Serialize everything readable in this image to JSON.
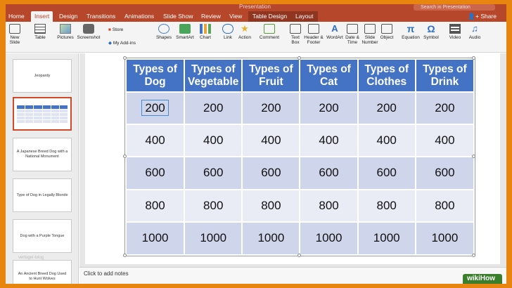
{
  "window": {
    "title": "Presentation",
    "search_placeholder": "Search in Presentation"
  },
  "tabs": [
    "Home",
    "Insert",
    "Design",
    "Transitions",
    "Animations",
    "Slide Show",
    "Review",
    "View"
  ],
  "active_tab": "Insert",
  "context_tabs": [
    "Table Design",
    "Layout"
  ],
  "share_label": "Share",
  "toolbar": {
    "new_slide": "New\nSlide",
    "table": "Table",
    "pictures": "Pictures",
    "screenshot": "Screenshot",
    "store": "Store",
    "my_addins": "My Add-ins",
    "shapes": "Shapes",
    "smartart": "SmartArt",
    "chart": "Chart",
    "link": "Link",
    "action": "Action",
    "comment": "Comment",
    "text_box": "Text\nBox",
    "header_footer": "Header &\nFooter",
    "wordart": "WordArt",
    "date_time": "Date &\nTime",
    "slide_number": "Slide\nNumber",
    "object": "Object",
    "equation": "Equation",
    "symbol": "Symbol",
    "video": "Video",
    "audio": "Audio"
  },
  "slides": [
    {
      "text": "Jeopardy"
    },
    {
      "text": ""
    },
    {
      "text": "A Japanese Breed Dog with a National Monument"
    },
    {
      "text": "Type of Dog in Legally Blonde"
    },
    {
      "text": "Dog with a Purple Tongue"
    },
    {
      "text": "An Ancient Breed Dog Used to Hunt Wolves"
    }
  ],
  "watermark": "vertogel-tvlog",
  "table": {
    "headers": [
      "Types of Dog",
      "Types of Vegetable",
      "Types of Fruit",
      "Types of Cat",
      "Types of Clothes",
      "Types of Drink"
    ],
    "rows": [
      [
        "200",
        "200",
        "200",
        "200",
        "200",
        "200"
      ],
      [
        "400",
        "400",
        "400",
        "400",
        "400",
        "400"
      ],
      [
        "600",
        "600",
        "600",
        "600",
        "600",
        "600"
      ],
      [
        "800",
        "800",
        "800",
        "800",
        "800",
        "800"
      ],
      [
        "1000",
        "1000",
        "1000",
        "1000",
        "1000",
        "1000"
      ]
    ]
  },
  "notes_placeholder": "Click to add notes",
  "logo_text": "wikiHow",
  "colors": {
    "ribbon": "#b7472a",
    "header_fill": "#4472c4",
    "row_odd": "#cfd5ea",
    "row_even": "#e9ebf5",
    "frame": "#e8850f"
  }
}
